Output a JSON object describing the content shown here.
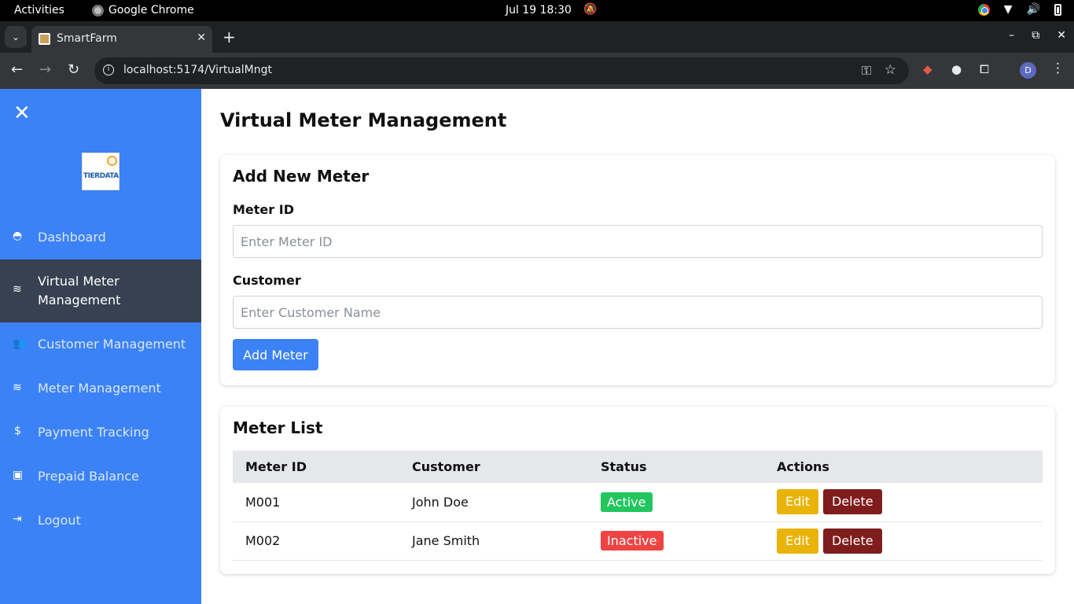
{
  "os": {
    "activities": "Activities",
    "app_name": "Google Chrome",
    "clock": "Jul 19  18:30"
  },
  "browser": {
    "tab_title": "SmartFarm",
    "url": "localhost:5174/VirtualMngt",
    "profile_initial": "D"
  },
  "sidebar": {
    "items": [
      {
        "label": "Dashboard",
        "icon": "gauge-icon"
      },
      {
        "label": "Virtual Meter Management",
        "icon": "water-icon",
        "active": true
      },
      {
        "label": "Customer Management",
        "icon": "users-icon"
      },
      {
        "label": "Meter Management",
        "icon": "water-icon"
      },
      {
        "label": "Payment Tracking",
        "icon": "dollar-icon"
      },
      {
        "label": "Prepaid Balance",
        "icon": "money-icon"
      },
      {
        "label": "Logout",
        "icon": "logout-icon"
      }
    ],
    "logo_text": "TIERDATA"
  },
  "main": {
    "title": "Virtual Meter Management",
    "add_form": {
      "heading": "Add New Meter",
      "meter_id_label": "Meter ID",
      "meter_id_placeholder": "Enter Meter ID",
      "customer_label": "Customer",
      "customer_placeholder": "Enter Customer Name",
      "submit_label": "Add Meter"
    },
    "list": {
      "heading": "Meter List",
      "columns": [
        "Meter ID",
        "Customer",
        "Status",
        "Actions"
      ],
      "rows": [
        {
          "meter_id": "M001",
          "customer": "John Doe",
          "status": "Active"
        },
        {
          "meter_id": "M002",
          "customer": "Jane Smith",
          "status": "Inactive"
        }
      ],
      "edit_label": "Edit",
      "delete_label": "Delete"
    }
  },
  "colors": {
    "sidebar_bg": "#3b82f6",
    "sidebar_active_bg": "#374151",
    "badge_active": "#22c55e",
    "badge_inactive": "#ef4444",
    "edit_button": "#eab308",
    "delete_button": "#7f1d1d"
  }
}
